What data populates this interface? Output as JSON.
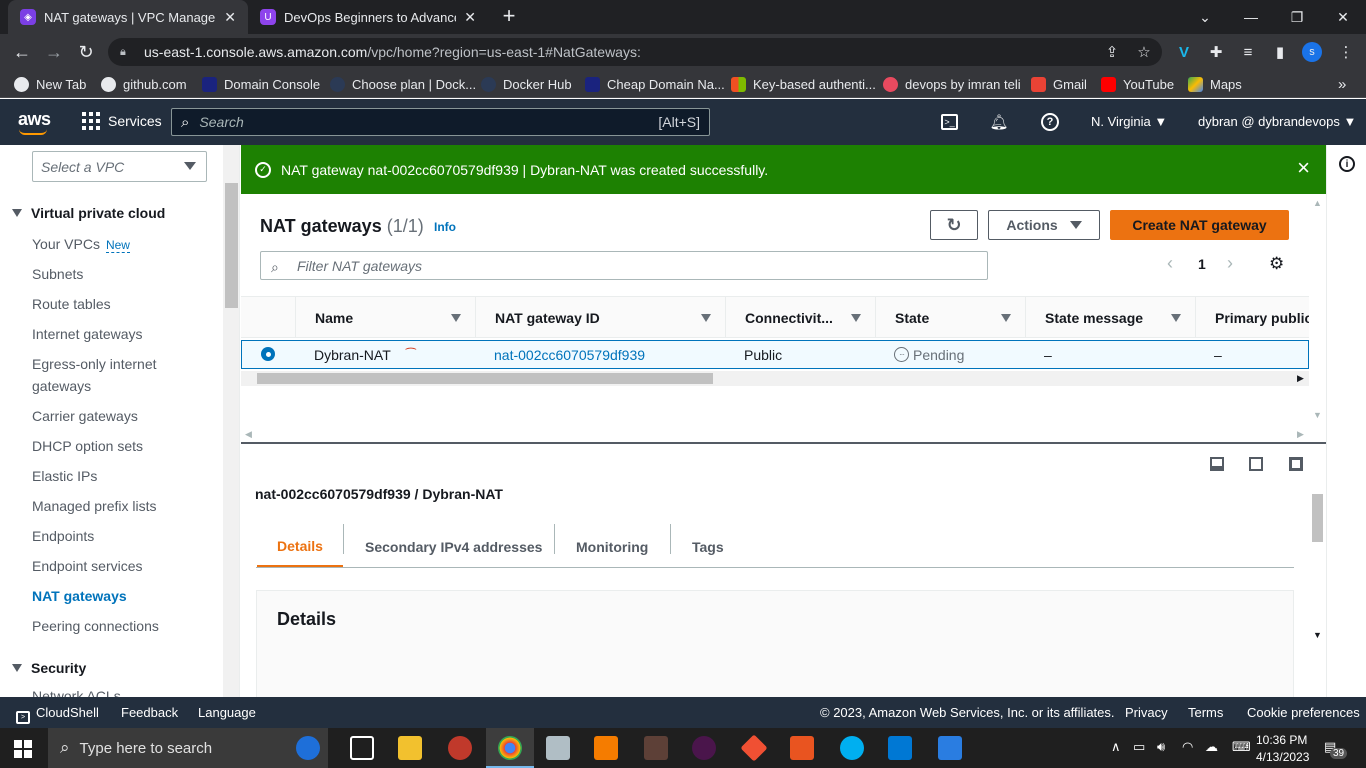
{
  "browser": {
    "tabs": [
      {
        "title": "NAT gateways | VPC Managemen",
        "active": true
      },
      {
        "title": "DevOps Beginners to Advanced |",
        "active": false
      }
    ],
    "new_tab": "+",
    "url_host": "us-east-1.console.aws.amazon.com",
    "url_path": "/vpc/home?region=us-east-1#NatGateways:",
    "profile_initial": "s",
    "bookmarks": [
      "New Tab",
      "github.com",
      "Domain Console",
      "Choose plan | Dock...",
      "Docker Hub",
      "Cheap Domain Na...",
      "Key-based authenti...",
      "devops by imran teli",
      "Gmail",
      "YouTube",
      "Maps"
    ],
    "bookmarks_more": "»"
  },
  "aws_header": {
    "logo": "aws",
    "services": "Services",
    "search_placeholder": "Search",
    "search_shortcut": "[Alt+S]",
    "region": "N. Virginia",
    "account": "dybran @ dybrandevops"
  },
  "sidebar": {
    "vpc_select_placeholder": "Select a VPC",
    "section1": "Virtual private cloud",
    "items": [
      {
        "label": "Your VPCs",
        "badge": "New"
      },
      {
        "label": "Subnets"
      },
      {
        "label": "Route tables"
      },
      {
        "label": "Internet gateways"
      },
      {
        "label": "Egress-only internet gateways"
      },
      {
        "label": "Carrier gateways"
      },
      {
        "label": "DHCP option sets"
      },
      {
        "label": "Elastic IPs"
      },
      {
        "label": "Managed prefix lists"
      },
      {
        "label": "Endpoints"
      },
      {
        "label": "Endpoint services"
      },
      {
        "label": "NAT gateways",
        "active": true
      },
      {
        "label": "Peering connections"
      }
    ],
    "section2": "Security",
    "partial_item": "Network ACLs"
  },
  "flash": {
    "message": "NAT gateway nat-002cc6070579df939 | Dybran-NAT was created successfully.",
    "close": "×"
  },
  "panel": {
    "title": "NAT gateways",
    "count": "(1/1)",
    "info": "Info",
    "actions_label": "Actions",
    "create_label": "Create NAT gateway",
    "filter_placeholder": "Filter NAT gateways",
    "page_number": "1",
    "columns": [
      "Name",
      "NAT gateway ID",
      "Connectivit...",
      "State",
      "State message",
      "Primary public"
    ],
    "row": {
      "name": "Dybran-NAT",
      "nat_id": "nat-002cc6070579df939",
      "connectivity": "Public",
      "state": "Pending",
      "state_message": "–",
      "primary_public": "–"
    }
  },
  "detail": {
    "title": "nat-002cc6070579df939 / Dybran-NAT",
    "tabs": [
      "Details",
      "Secondary IPv4 addresses",
      "Monitoring",
      "Tags"
    ],
    "active_tab": "Details",
    "section_title": "Details"
  },
  "aws_footer": {
    "cloudshell": "CloudShell",
    "feedback": "Feedback",
    "language": "Language",
    "copyright": "© 2023, Amazon Web Services, Inc. or its affiliates.",
    "privacy": "Privacy",
    "terms": "Terms",
    "cookie": "Cookie preferences"
  },
  "taskbar": {
    "search_placeholder": "Type here to search",
    "time": "10:36 PM",
    "date": "4/13/2023",
    "notifications": "39"
  },
  "colors": {
    "aws_header": "#232f3e",
    "aws_orange": "#ec7211",
    "success_green": "#1d8102",
    "link_blue": "#0073bb"
  }
}
